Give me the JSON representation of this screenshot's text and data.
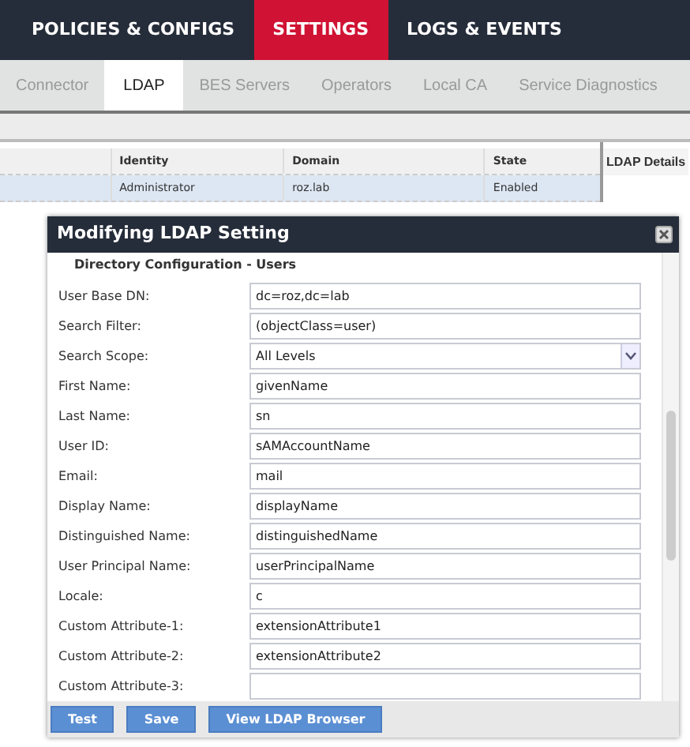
{
  "main_nav": [
    {
      "label": "POLICIES & CONFIGS",
      "selected": false
    },
    {
      "label": "SETTINGS",
      "selected": true
    },
    {
      "label": "LOGS & EVENTS",
      "selected": false
    }
  ],
  "sub_tabs": [
    {
      "label": "Connector",
      "selected": false
    },
    {
      "label": "LDAP",
      "selected": true
    },
    {
      "label": "BES Servers",
      "selected": false
    },
    {
      "label": "Operators",
      "selected": false
    },
    {
      "label": "Local CA",
      "selected": false
    },
    {
      "label": "Service Diagnostics",
      "selected": false
    }
  ],
  "table": {
    "columns": [
      "Identity",
      "Domain",
      "State"
    ],
    "rows": [
      {
        "cells": [
          "Administrator",
          "roz.lab",
          "Enabled"
        ],
        "selected": true
      }
    ]
  },
  "details_panel": {
    "title": "LDAP Details"
  },
  "dialog": {
    "title": "Modifying LDAP Setting",
    "section": "Directory Configuration - Users",
    "fields": [
      {
        "label": "User Base DN:",
        "kind": "text",
        "value": "dc=roz,dc=lab"
      },
      {
        "label": "Search Filter:",
        "kind": "text",
        "value": "(objectClass=user)"
      },
      {
        "label": "Search Scope:",
        "kind": "select",
        "value": "All Levels"
      },
      {
        "label": "First Name:",
        "kind": "text",
        "value": "givenName"
      },
      {
        "label": "Last Name:",
        "kind": "text",
        "value": "sn"
      },
      {
        "label": "User ID:",
        "kind": "text",
        "value": "sAMAccountName"
      },
      {
        "label": "Email:",
        "kind": "text",
        "value": "mail"
      },
      {
        "label": "Display Name:",
        "kind": "text",
        "value": "displayName"
      },
      {
        "label": "Distinguished Name:",
        "kind": "text",
        "value": "distinguishedName"
      },
      {
        "label": "User Principal Name:",
        "kind": "text",
        "value": "userPrincipalName"
      },
      {
        "label": "Locale:",
        "kind": "text",
        "value": "c"
      },
      {
        "label": "Custom Attribute-1:",
        "kind": "text",
        "value": "extensionAttribute1"
      },
      {
        "label": "Custom Attribute-2:",
        "kind": "text",
        "value": "extensionAttribute2"
      },
      {
        "label": "Custom Attribute-3:",
        "kind": "text"
      }
    ],
    "buttons": [
      "Test",
      "Save",
      "View LDAP Browser"
    ]
  }
}
